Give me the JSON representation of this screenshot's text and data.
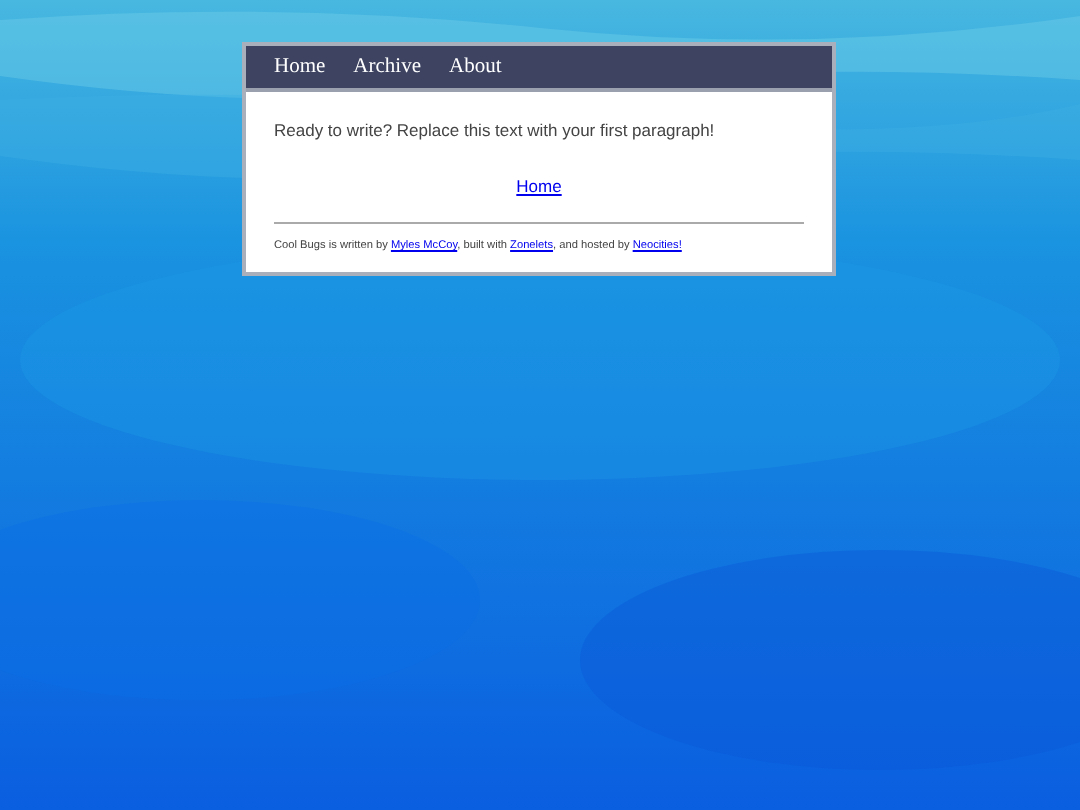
{
  "nav": {
    "items": [
      {
        "label": "Home"
      },
      {
        "label": "Archive"
      },
      {
        "label": "About"
      }
    ]
  },
  "content": {
    "paragraph": "Ready to write? Replace this text with your first paragraph!",
    "link": "Home"
  },
  "footer": {
    "parts": [
      {
        "kind": "text",
        "text": "Cool Bugs is written by "
      },
      {
        "kind": "link",
        "text": "Myles McCoy"
      },
      {
        "kind": "text",
        "text": ", built with "
      },
      {
        "kind": "link",
        "text": "Zonelets"
      },
      {
        "kind": "text",
        "text": ", and hosted by "
      },
      {
        "kind": "link",
        "text": "Neocities!"
      }
    ]
  }
}
